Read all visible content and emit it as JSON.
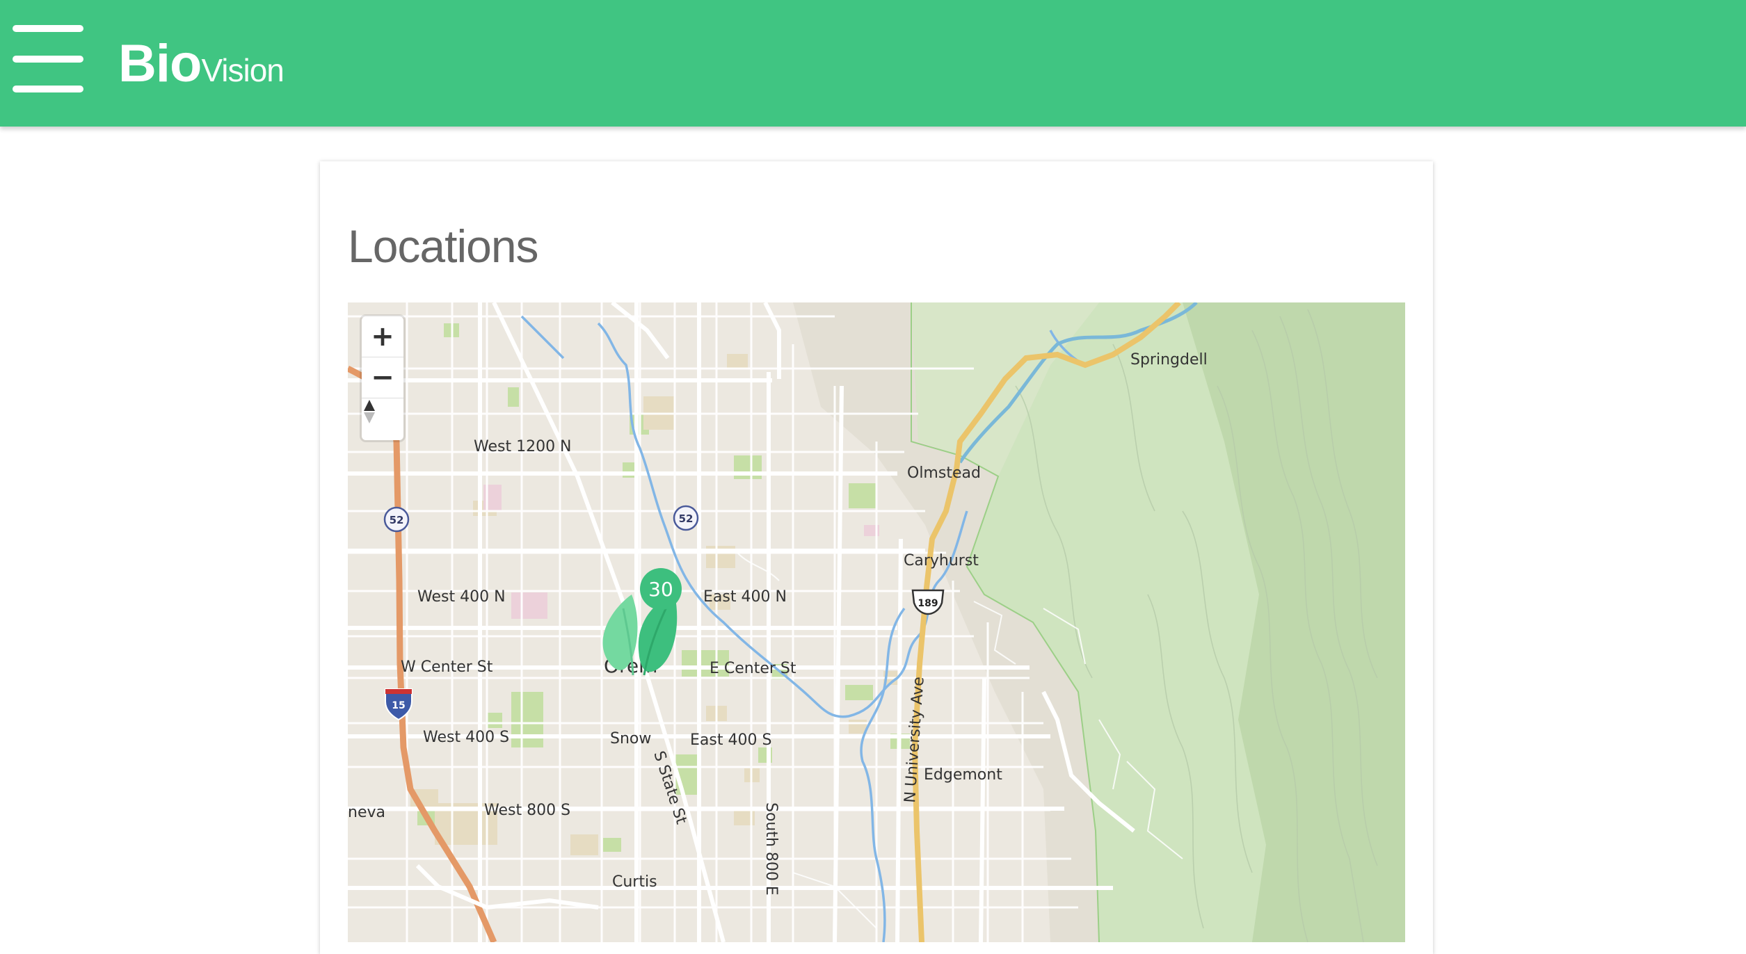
{
  "header": {
    "menu_icon": "hamburger-menu-icon",
    "brand_bold": "Bio",
    "brand_light": "Vision",
    "background": "#40c582"
  },
  "page": {
    "title": "Locations"
  },
  "map": {
    "controls": {
      "zoom_in": "+",
      "zoom_out": "−",
      "compass_icon": "compass-icon"
    },
    "labels": {
      "springdell": "Springdell",
      "olmstead": "Olmstead",
      "caryhurst": "Caryhurst",
      "west_1200_n": "West 1200 N",
      "west_400_n": "West 400 N",
      "east_400_n": "East 400 N",
      "orem": "Orem",
      "w_center_st": "W Center St",
      "e_center_st": "E Center St",
      "west_400_s": "West 400 S",
      "snow": "Snow",
      "east_400_s": "East 400 S",
      "s_state_st": "S State St",
      "n_university_ave": "N University Ave",
      "edgemont": "Edgemont",
      "west_800_s": "West 800 S",
      "south_800_e": "South 800 E",
      "geneva": "neva",
      "curtis": "Curtis"
    },
    "shields": {
      "route_52_west": "52",
      "route_52_east": "52",
      "us_189": "189",
      "i_15": "15"
    },
    "marker": {
      "count": "30",
      "icon": "leaf-marker-icon",
      "color": "#3dbf7e"
    }
  }
}
